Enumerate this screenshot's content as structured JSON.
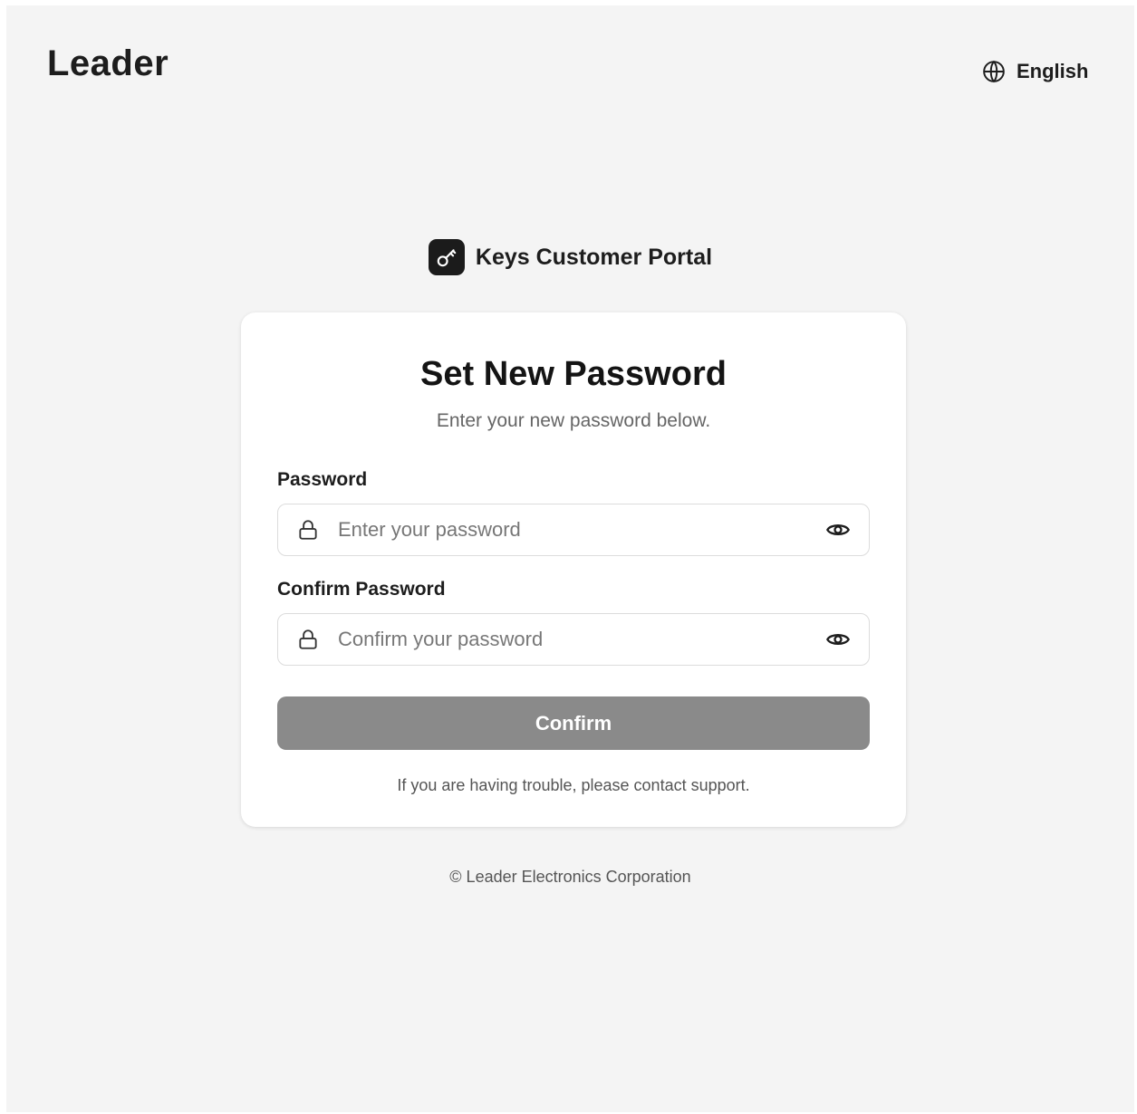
{
  "header": {
    "logo_text": "Leader",
    "language_label": "English"
  },
  "portal": {
    "title": "Keys Customer Portal"
  },
  "card": {
    "title": "Set New Password",
    "subtitle": "Enter your new password below.",
    "password": {
      "label": "Password",
      "placeholder": "Enter your password",
      "value": ""
    },
    "confirm_password": {
      "label": "Confirm Password",
      "placeholder": "Confirm your password",
      "value": ""
    },
    "confirm_button_label": "Confirm",
    "help_text": "If you are having trouble, please contact support."
  },
  "footer": {
    "copyright": "© Leader Electronics Corporation"
  },
  "colors": {
    "page_background": "#f4f4f4",
    "card_background": "#ffffff",
    "button_disabled": "#8a8a8a",
    "text_primary": "#1d1d1d",
    "text_muted": "#666666"
  },
  "icons": {
    "language": "globe-icon",
    "portal": "key-icon",
    "field_prefix": "lock-icon",
    "field_suffix": "eye-icon"
  }
}
